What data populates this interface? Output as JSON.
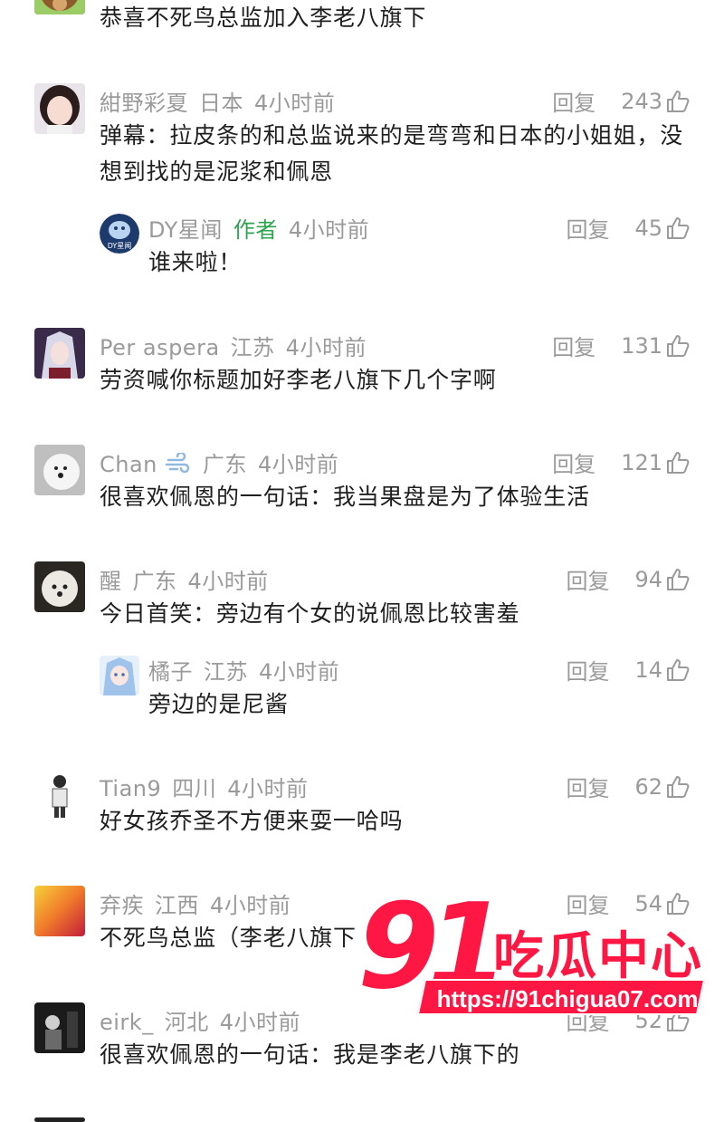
{
  "comments": [
    {
      "user": "",
      "location": "",
      "time": "",
      "text": "恭喜不死鸟总监加入李老八旗下",
      "reply_label": "",
      "likes": ""
    },
    {
      "user": "紺野彩夏",
      "location": "日本",
      "time": "4小时前",
      "text": "弹幕：拉皮条的和总监说来的是弯弯和日本的小姐姐，没想到找的是泥浆和佩恩",
      "reply_label": "回复",
      "likes": "243"
    },
    {
      "user": "DY星闻",
      "author_tag": "作者",
      "time": "4小时前",
      "text": "谁来啦！",
      "reply_label": "回复",
      "likes": "45",
      "avatar_text": "DY星闻"
    },
    {
      "user": "Per aspera",
      "location": "江苏",
      "time": "4小时前",
      "text": "劳资喊你标题加好李老八旗下几个字啊",
      "reply_label": "回复",
      "likes": "131"
    },
    {
      "user": "Chan",
      "location": "广东",
      "time": "4小时前",
      "text": "很喜欢佩恩的一句话：我当果盘是为了体验生活",
      "reply_label": "回复",
      "likes": "121"
    },
    {
      "user": "醒",
      "location": "广东",
      "time": "4小时前",
      "text": "今日首笑：旁边有个女的说佩恩比较害羞",
      "reply_label": "回复",
      "likes": "94"
    },
    {
      "user": "橘子",
      "location": "江苏",
      "time": "4小时前",
      "text": "旁边的是尼酱",
      "reply_label": "回复",
      "likes": "14"
    },
    {
      "user": "Tian9",
      "location": "四川",
      "time": "4小时前",
      "text": "好女孩乔圣不方便来耍一哈吗",
      "reply_label": "回复",
      "likes": "62"
    },
    {
      "user": "弃疾",
      "location": "江西",
      "time": "4小时前",
      "text": "不死鸟总监（李老八旗下",
      "reply_label": "回复",
      "likes": "54"
    },
    {
      "user": "eirk_",
      "location": "河北",
      "time": "4小时前",
      "text": "很喜欢佩恩的一句话：我是李老八旗下的",
      "reply_label": "回复",
      "likes": "52"
    }
  ],
  "watermark": {
    "number": "91",
    "brand": "吃瓜中心",
    "url": "https://91chigua07.com"
  },
  "colors": {
    "author_tag": "#2ea44f",
    "watermark": "#ff1744",
    "meta": "#9a9a9a"
  }
}
